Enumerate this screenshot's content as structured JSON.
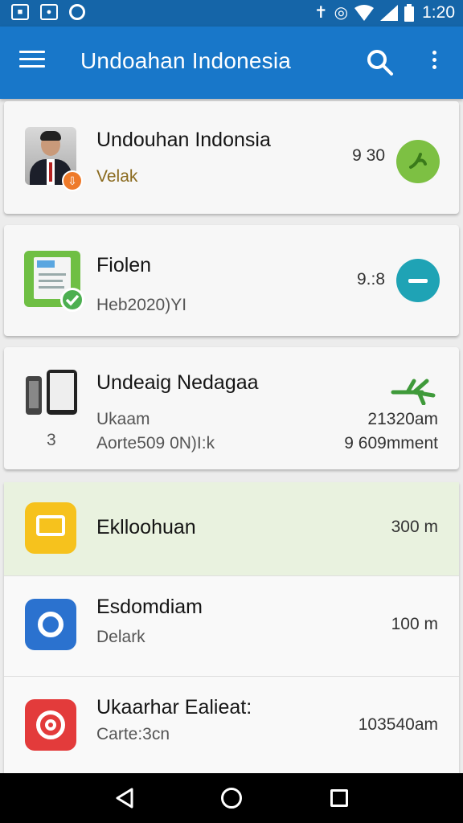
{
  "status_bar": {
    "time": "1:20",
    "icons": [
      "notification-box-icon",
      "image-icon",
      "circle-app-icon",
      "bluetooth-icon",
      "alarm-icon",
      "wifi-icon",
      "signal-icon",
      "battery-icon"
    ]
  },
  "app_bar": {
    "title": "Undoahan Indonesia",
    "icons": [
      "menu-icon",
      "search-icon",
      "more-vert-icon"
    ]
  },
  "cards": [
    {
      "title": "Undouhan Indonsia",
      "subtitle": "Velak",
      "value": "9 30",
      "icon": "person-avatar",
      "badge": "download-badge-icon",
      "accent": "#7dc043"
    },
    {
      "title": "Fiolen",
      "subtitle": "Heb2020)YI",
      "value": "9.:8",
      "icon": "document-icon",
      "badge": "check-badge-icon",
      "accent": "#1fa3b5"
    },
    {
      "title": "Undeaig Nedagaa",
      "subtitle": "Ukaam",
      "subtitle2": "Aorte509 0N)I:k",
      "side_number": "3",
      "value": "21320am",
      "value2": "9 609mment",
      "icon": "devices-icon",
      "accent": "#3f9a3a"
    }
  ],
  "list": [
    {
      "title": "Eklloohuan",
      "subtitle": "",
      "value": "300 m",
      "icon": "chat-bubble-icon",
      "color": "#f6c21d",
      "highlighted": true
    },
    {
      "title": "Esdomdiam",
      "subtitle": "Delark",
      "value": "100 m",
      "icon": "camera-icon",
      "color": "#2b72cf"
    },
    {
      "title": "Ukaarhar Ealieat:",
      "subtitle": "Carte:3cn",
      "value": "103540am",
      "icon": "target-icon",
      "color": "#e33b3b"
    }
  ],
  "colors": {
    "status_bar": "#1565a8",
    "app_bar": "#1877c9",
    "background": "#ececec",
    "highlight_row": "#e9f2df"
  }
}
